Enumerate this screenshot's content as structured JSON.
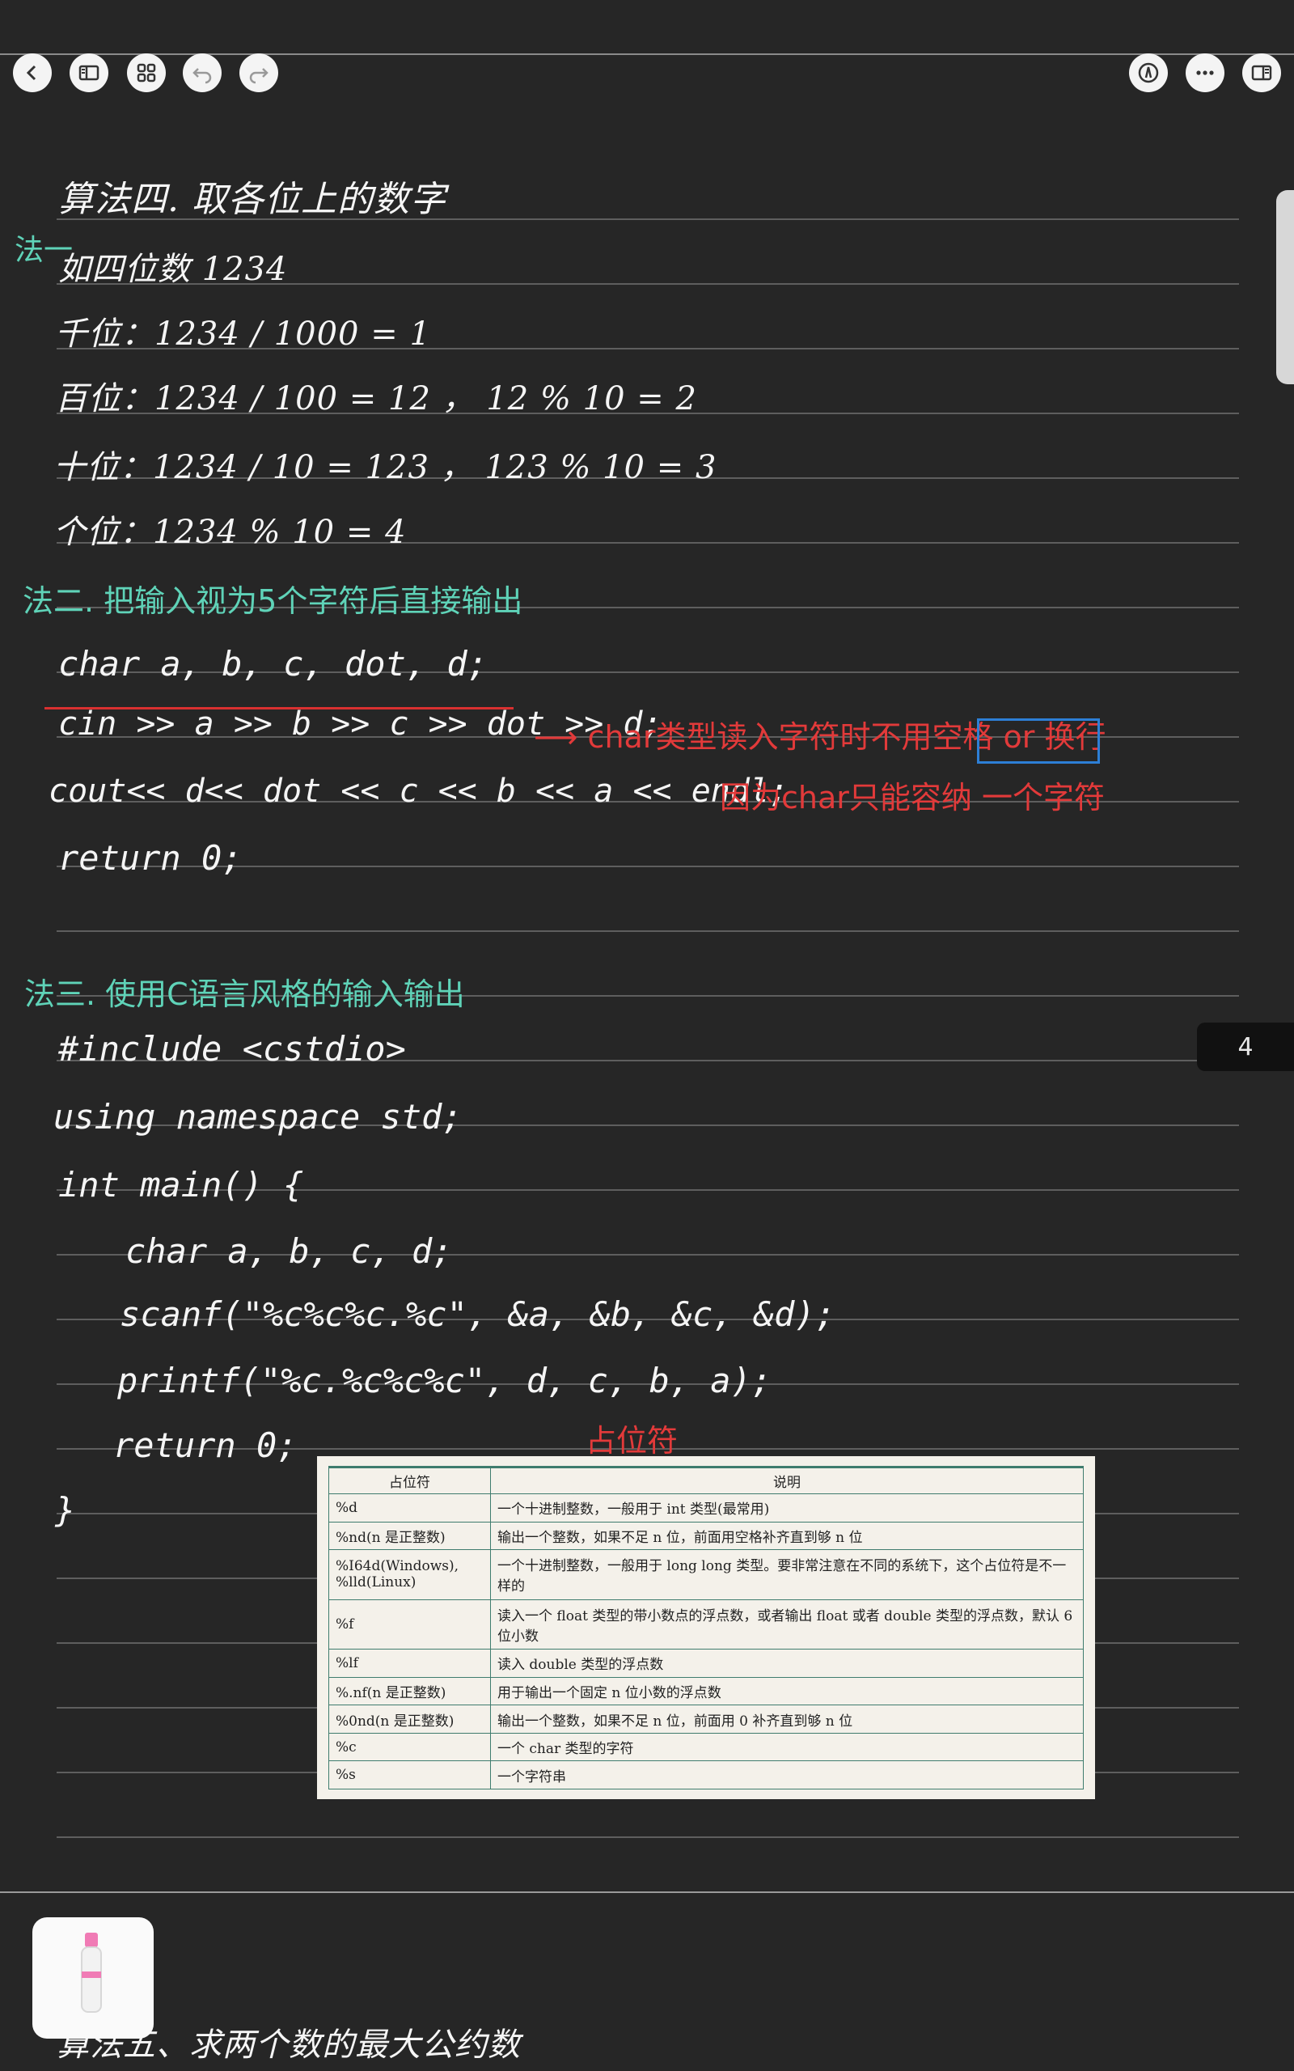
{
  "toolbar": {
    "icons": [
      "back-icon",
      "sidebar-icon",
      "grid-icon",
      "undo-icon",
      "redo-icon",
      "pen-mode-icon",
      "more-icon",
      "panel-icon"
    ]
  },
  "notes": {
    "title": "算法四. 取各位上的数字",
    "method1_label": "法一",
    "example": "如四位数 1234",
    "thousands": "千位：1234 / 1000 = 1",
    "hundreds": "百位：1234 / 100 = 12 ， 12 % 10 = 2",
    "tens": "十位：1234 / 10 = 123 ， 123 % 10 = 3",
    "ones": "个位：1234 % 10 = 4",
    "method2": "法二. 把输入视为5个字符后直接输出",
    "m2_decl": "char a, b, c, dot, d;",
    "m2_cin": "cin >> a >> b >> c >> dot >> d;",
    "m2_note1": "⟶ char类型读入字符时不用空格 or 换行",
    "m2_cout": "cout<< d<< dot << c << b << a << endl;",
    "m2_note2": "因为char只能容纳",
    "m2_note2_boxed": "一个字符",
    "m2_return": "return 0;",
    "method3": "法三. 使用C语言风格的输入输出",
    "m3_include": "#include <cstdio>",
    "m3_using": "using namespace std;",
    "m3_main": "int main() {",
    "m3_decl": "char a, b, c, d;",
    "m3_scanf": "scanf(\"%c%c%c.%c\", &a, &b, &c, &d);",
    "m3_printf": "printf(\"%c.%c%c%c\", d, c, b, a);",
    "m3_return": "return 0;",
    "m3_close": "}",
    "placeholder_label": "占位符",
    "next_title": "算法五、求两个数的最大公约数"
  },
  "table": {
    "headers": [
      "占位符",
      "说明"
    ],
    "rows": [
      [
        "%d",
        "一个十进制整数，一般用于 int 类型(最常用)"
      ],
      [
        "%nd(n 是正整数)",
        "输出一个整数，如果不足 n 位，前面用空格补齐直到够 n 位"
      ],
      [
        "%I64d(Windows), %lld(Linux)",
        "一个十进制整数，一般用于 long long 类型。要非常注意在不同的系统下，这个占位符是不一样的"
      ],
      [
        "%f",
        "读入一个 float 类型的带小数点的浮点数，或者输出 float 或者 double 类型的浮点数，默认 6 位小数"
      ],
      [
        "%lf",
        "读入 double 类型的浮点数"
      ],
      [
        "%.nf(n 是正整数)",
        "用于输出一个固定 n 位小数的浮点数"
      ],
      [
        "%0nd(n 是正整数)",
        "输出一个整数，如果不足 n 位，前面用 0 补齐直到够 n 位"
      ],
      [
        "%c",
        "一个 char 类型的字符"
      ],
      [
        "%s",
        "一个字符串"
      ]
    ]
  },
  "page_number": "4",
  "colors": {
    "teal": "#5fd3b8",
    "red": "#e23a3a",
    "blue": "#2d7fd6",
    "background": "#262626"
  }
}
